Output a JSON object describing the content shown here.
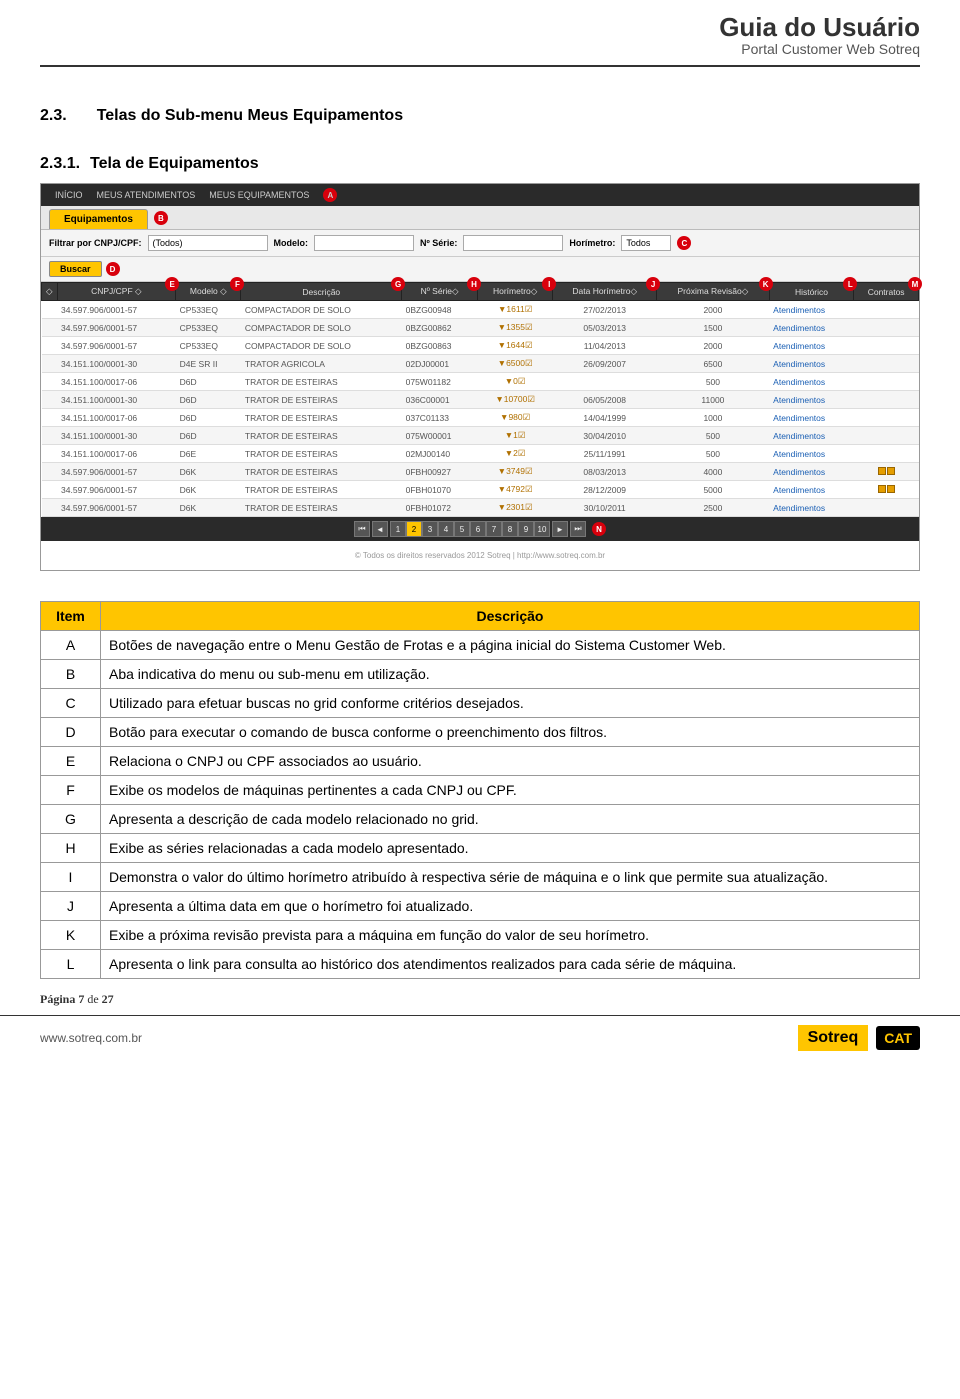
{
  "header": {
    "title": "Guia do Usuário",
    "subtitle": "Portal Customer Web Sotreq"
  },
  "section": {
    "num": "2.3.",
    "title": "Telas do Sub-menu Meus Equipamentos",
    "sub_num": "2.3.1.",
    "sub_title": "Tela de Equipamentos"
  },
  "screenshot": {
    "nav": {
      "inicio": "INÍCIO",
      "atend": "MEUS ATENDIMENTOS",
      "equip": "MEUS EQUIPAMENTOS"
    },
    "tab": "Equipamentos",
    "filter": {
      "label": "Filtrar por CNPJ/CPF:",
      "todos": "(Todos)",
      "modelo_lbl": "Modelo:",
      "serie_lbl": "Nº Série:",
      "horim_lbl": "Horímetro:",
      "horim_val": "Todos",
      "buscar": "Buscar"
    },
    "badges": {
      "A": "A",
      "B": "B",
      "C": "C",
      "D": "D",
      "E": "E",
      "F": "F",
      "G": "G",
      "H": "H",
      "I": "I",
      "J": "J",
      "K": "K",
      "L": "L",
      "M": "M",
      "N": "N"
    },
    "cols": {
      "cnpj": "CNPJ/CPF",
      "modelo": "Modelo",
      "desc": "Descrição",
      "serie": "Nº Série",
      "horim": "Horímetro",
      "data": "Data Horímetro",
      "revisao": "Próxima Revisão",
      "hist": "Histórico",
      "contr": "Contratos"
    },
    "rows": [
      {
        "cnpj": "34.597.906/0001-57",
        "mod": "CP533EQ",
        "desc": "COMPACTADOR DE SOLO",
        "ser": "0BZG00948",
        "hor": "1611",
        "data": "27/02/2013",
        "rev": "2000",
        "hist": "Atendimentos",
        "ico": false
      },
      {
        "cnpj": "34.597.906/0001-57",
        "mod": "CP533EQ",
        "desc": "COMPACTADOR DE SOLO",
        "ser": "0BZG00862",
        "hor": "1355",
        "data": "05/03/2013",
        "rev": "1500",
        "hist": "Atendimentos",
        "ico": false
      },
      {
        "cnpj": "34.597.906/0001-57",
        "mod": "CP533EQ",
        "desc": "COMPACTADOR DE SOLO",
        "ser": "0BZG00863",
        "hor": "1644",
        "data": "11/04/2013",
        "rev": "2000",
        "hist": "Atendimentos",
        "ico": false
      },
      {
        "cnpj": "34.151.100/0001-30",
        "mod": "D4E SR II",
        "desc": "TRATOR AGRICOLA",
        "ser": "02DJ00001",
        "hor": "6500",
        "data": "26/09/2007",
        "rev": "6500",
        "hist": "Atendimentos",
        "ico": false
      },
      {
        "cnpj": "34.151.100/0017-06",
        "mod": "D6D",
        "desc": "TRATOR DE ESTEIRAS",
        "ser": "075W01182",
        "hor": "0",
        "data": "",
        "rev": "500",
        "hist": "Atendimentos",
        "ico": false
      },
      {
        "cnpj": "34.151.100/0001-30",
        "mod": "D6D",
        "desc": "TRATOR DE ESTEIRAS",
        "ser": "036C00001",
        "hor": "10700",
        "data": "06/05/2008",
        "rev": "11000",
        "hist": "Atendimentos",
        "ico": false
      },
      {
        "cnpj": "34.151.100/0017-06",
        "mod": "D6D",
        "desc": "TRATOR DE ESTEIRAS",
        "ser": "037C01133",
        "hor": "980",
        "data": "14/04/1999",
        "rev": "1000",
        "hist": "Atendimentos",
        "ico": false
      },
      {
        "cnpj": "34.151.100/0001-30",
        "mod": "D6D",
        "desc": "TRATOR DE ESTEIRAS",
        "ser": "075W00001",
        "hor": "1",
        "data": "30/04/2010",
        "rev": "500",
        "hist": "Atendimentos",
        "ico": false
      },
      {
        "cnpj": "34.151.100/0017-06",
        "mod": "D6E",
        "desc": "TRATOR DE ESTEIRAS",
        "ser": "02MJ00140",
        "hor": "2",
        "data": "25/11/1991",
        "rev": "500",
        "hist": "Atendimentos",
        "ico": false
      },
      {
        "cnpj": "34.597.906/0001-57",
        "mod": "D6K",
        "desc": "TRATOR DE ESTEIRAS",
        "ser": "0FBH00927",
        "hor": "3749",
        "data": "08/03/2013",
        "rev": "4000",
        "hist": "Atendimentos",
        "ico": true
      },
      {
        "cnpj": "34.597.906/0001-57",
        "mod": "D6K",
        "desc": "TRATOR DE ESTEIRAS",
        "ser": "0FBH01070",
        "hor": "4792",
        "data": "28/12/2009",
        "rev": "5000",
        "hist": "Atendimentos",
        "ico": true
      },
      {
        "cnpj": "34.597.906/0001-57",
        "mod": "D6K",
        "desc": "TRATOR DE ESTEIRAS",
        "ser": "0FBH01072",
        "hor": "2301",
        "data": "30/10/2011",
        "rev": "2500",
        "hist": "Atendimentos",
        "ico": false
      }
    ],
    "pager": [
      "1",
      "2",
      "3",
      "4",
      "5",
      "6",
      "7",
      "8",
      "9",
      "10"
    ],
    "footer": "© Todos os direitos reservados 2012 Sotreq | http://www.sotreq.com.br"
  },
  "desc": {
    "h_item": "Item",
    "h_desc": "Descrição",
    "rows": [
      {
        "k": "A",
        "v": "Botões de navegação entre o Menu Gestão de Frotas e a página inicial do Sistema Customer Web."
      },
      {
        "k": "B",
        "v": "Aba indicativa do menu ou sub-menu em utilização."
      },
      {
        "k": "C",
        "v": "Utilizado para efetuar buscas no grid conforme critérios desejados."
      },
      {
        "k": "D",
        "v": "Botão para executar o comando de busca conforme o preenchimento dos filtros."
      },
      {
        "k": "E",
        "v": "Relaciona o CNPJ ou CPF associados ao usuário."
      },
      {
        "k": "F",
        "v": "Exibe os modelos de máquinas pertinentes a cada CNPJ ou CPF."
      },
      {
        "k": "G",
        "v": "Apresenta a descrição de cada modelo relacionado no grid."
      },
      {
        "k": "H",
        "v": "Exibe as séries relacionadas a cada modelo apresentado."
      },
      {
        "k": "I",
        "v": "Demonstra o valor do último horímetro atribuído à respectiva série de máquina e o link que permite sua atualização."
      },
      {
        "k": "J",
        "v": "Apresenta a última data em que o horímetro foi atualizado."
      },
      {
        "k": "K",
        "v": "Exibe a próxima revisão prevista para a máquina em função do valor de seu horímetro."
      },
      {
        "k": "L",
        "v": "Apresenta o link para consulta ao histórico dos atendimentos realizados para cada série de máquina."
      }
    ]
  },
  "pageinfo": {
    "p1": "Página ",
    "num": "7",
    "p2": " de ",
    "total": "27"
  },
  "footer": {
    "url": "www.sotreq.com.br",
    "logo1": "Sotreq",
    "logo2": "CAT"
  }
}
